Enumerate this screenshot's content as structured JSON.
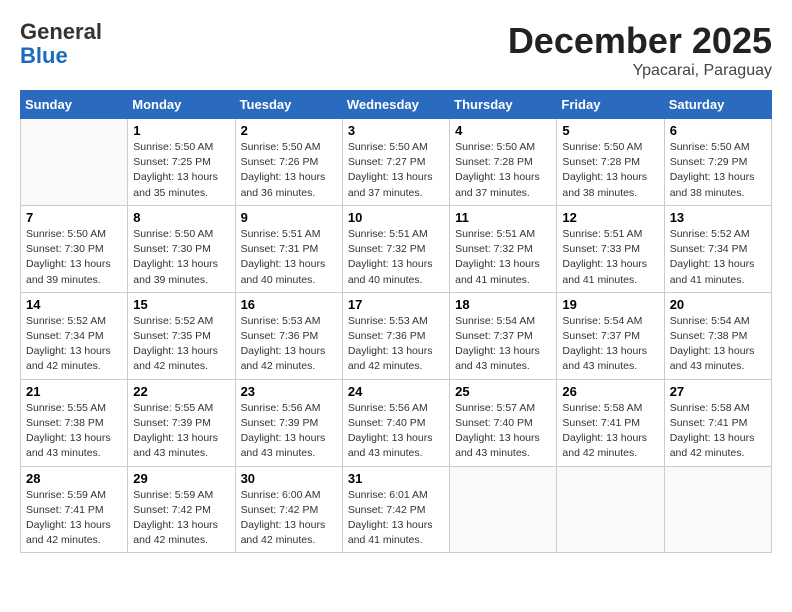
{
  "header": {
    "logo_line1": "General",
    "logo_line2": "Blue",
    "month": "December 2025",
    "location": "Ypacarai, Paraguay"
  },
  "days_of_week": [
    "Sunday",
    "Monday",
    "Tuesday",
    "Wednesday",
    "Thursday",
    "Friday",
    "Saturday"
  ],
  "weeks": [
    [
      {
        "day": "",
        "info": ""
      },
      {
        "day": "1",
        "info": "Sunrise: 5:50 AM\nSunset: 7:25 PM\nDaylight: 13 hours\nand 35 minutes."
      },
      {
        "day": "2",
        "info": "Sunrise: 5:50 AM\nSunset: 7:26 PM\nDaylight: 13 hours\nand 36 minutes."
      },
      {
        "day": "3",
        "info": "Sunrise: 5:50 AM\nSunset: 7:27 PM\nDaylight: 13 hours\nand 37 minutes."
      },
      {
        "day": "4",
        "info": "Sunrise: 5:50 AM\nSunset: 7:28 PM\nDaylight: 13 hours\nand 37 minutes."
      },
      {
        "day": "5",
        "info": "Sunrise: 5:50 AM\nSunset: 7:28 PM\nDaylight: 13 hours\nand 38 minutes."
      },
      {
        "day": "6",
        "info": "Sunrise: 5:50 AM\nSunset: 7:29 PM\nDaylight: 13 hours\nand 38 minutes."
      }
    ],
    [
      {
        "day": "7",
        "info": "Sunrise: 5:50 AM\nSunset: 7:30 PM\nDaylight: 13 hours\nand 39 minutes."
      },
      {
        "day": "8",
        "info": "Sunrise: 5:50 AM\nSunset: 7:30 PM\nDaylight: 13 hours\nand 39 minutes."
      },
      {
        "day": "9",
        "info": "Sunrise: 5:51 AM\nSunset: 7:31 PM\nDaylight: 13 hours\nand 40 minutes."
      },
      {
        "day": "10",
        "info": "Sunrise: 5:51 AM\nSunset: 7:32 PM\nDaylight: 13 hours\nand 40 minutes."
      },
      {
        "day": "11",
        "info": "Sunrise: 5:51 AM\nSunset: 7:32 PM\nDaylight: 13 hours\nand 41 minutes."
      },
      {
        "day": "12",
        "info": "Sunrise: 5:51 AM\nSunset: 7:33 PM\nDaylight: 13 hours\nand 41 minutes."
      },
      {
        "day": "13",
        "info": "Sunrise: 5:52 AM\nSunset: 7:34 PM\nDaylight: 13 hours\nand 41 minutes."
      }
    ],
    [
      {
        "day": "14",
        "info": "Sunrise: 5:52 AM\nSunset: 7:34 PM\nDaylight: 13 hours\nand 42 minutes."
      },
      {
        "day": "15",
        "info": "Sunrise: 5:52 AM\nSunset: 7:35 PM\nDaylight: 13 hours\nand 42 minutes."
      },
      {
        "day": "16",
        "info": "Sunrise: 5:53 AM\nSunset: 7:36 PM\nDaylight: 13 hours\nand 42 minutes."
      },
      {
        "day": "17",
        "info": "Sunrise: 5:53 AM\nSunset: 7:36 PM\nDaylight: 13 hours\nand 42 minutes."
      },
      {
        "day": "18",
        "info": "Sunrise: 5:54 AM\nSunset: 7:37 PM\nDaylight: 13 hours\nand 43 minutes."
      },
      {
        "day": "19",
        "info": "Sunrise: 5:54 AM\nSunset: 7:37 PM\nDaylight: 13 hours\nand 43 minutes."
      },
      {
        "day": "20",
        "info": "Sunrise: 5:54 AM\nSunset: 7:38 PM\nDaylight: 13 hours\nand 43 minutes."
      }
    ],
    [
      {
        "day": "21",
        "info": "Sunrise: 5:55 AM\nSunset: 7:38 PM\nDaylight: 13 hours\nand 43 minutes."
      },
      {
        "day": "22",
        "info": "Sunrise: 5:55 AM\nSunset: 7:39 PM\nDaylight: 13 hours\nand 43 minutes."
      },
      {
        "day": "23",
        "info": "Sunrise: 5:56 AM\nSunset: 7:39 PM\nDaylight: 13 hours\nand 43 minutes."
      },
      {
        "day": "24",
        "info": "Sunrise: 5:56 AM\nSunset: 7:40 PM\nDaylight: 13 hours\nand 43 minutes."
      },
      {
        "day": "25",
        "info": "Sunrise: 5:57 AM\nSunset: 7:40 PM\nDaylight: 13 hours\nand 43 minutes."
      },
      {
        "day": "26",
        "info": "Sunrise: 5:58 AM\nSunset: 7:41 PM\nDaylight: 13 hours\nand 42 minutes."
      },
      {
        "day": "27",
        "info": "Sunrise: 5:58 AM\nSunset: 7:41 PM\nDaylight: 13 hours\nand 42 minutes."
      }
    ],
    [
      {
        "day": "28",
        "info": "Sunrise: 5:59 AM\nSunset: 7:41 PM\nDaylight: 13 hours\nand 42 minutes."
      },
      {
        "day": "29",
        "info": "Sunrise: 5:59 AM\nSunset: 7:42 PM\nDaylight: 13 hours\nand 42 minutes."
      },
      {
        "day": "30",
        "info": "Sunrise: 6:00 AM\nSunset: 7:42 PM\nDaylight: 13 hours\nand 42 minutes."
      },
      {
        "day": "31",
        "info": "Sunrise: 6:01 AM\nSunset: 7:42 PM\nDaylight: 13 hours\nand 41 minutes."
      },
      {
        "day": "",
        "info": ""
      },
      {
        "day": "",
        "info": ""
      },
      {
        "day": "",
        "info": ""
      }
    ]
  ]
}
